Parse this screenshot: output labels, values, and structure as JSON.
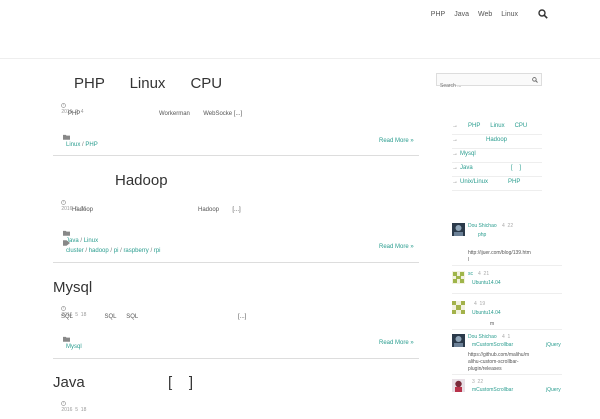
{
  "nav": {
    "items": [
      "PHP",
      "Java",
      "Web",
      "Linux"
    ]
  },
  "posts": [
    {
      "title": "PHP      Linux      CPU",
      "meta": "2016  9  4",
      "excerpt_a": "PHP",
      "excerpt_b": "Workerman        WebSocke [...]",
      "categories": [
        "Linux",
        "PHP"
      ],
      "read_more": "Read More"
    },
    {
      "title": "Hadoop",
      "meta": "2016  5  26",
      "excerpt_a": "Hadoop",
      "excerpt_b": "Hadoop        [...]",
      "categories": [
        "Java",
        "Linux"
      ],
      "tags": [
        "cluster",
        "hadoop",
        "pi",
        "raspberry",
        "rpi"
      ],
      "read_more": "Read More"
    },
    {
      "title": "Mysql",
      "meta": "2016  5  18",
      "excerpt_a": "SQL                   SQL      SQL",
      "excerpt_b": "[...]",
      "categories": [
        "Mysql"
      ],
      "read_more": "Read More"
    },
    {
      "title": "Java                    [    ]",
      "meta": "2016  5  18"
    }
  ],
  "sidebar": {
    "search_placeholder": "Search ...",
    "list": [
      "PHP      Linux      CPU",
      "Hadoop",
      "Mysql",
      "Java                       [    ]",
      "Unix/Linux            PHP"
    ],
    "comments": [
      {
        "author": "Dou Shichao",
        "time": "4  22",
        "line2": "php",
        "line3": "http://ijuer.com/blog/139.htm",
        "line4": "l"
      },
      {
        "author": "sc",
        "time": "4  21",
        "line2": "Ubuntu14.04"
      },
      {
        "time": "4  19",
        "line2": "Ubuntu14.04",
        "line3": "m"
      },
      {
        "author": "Dou Shichao",
        "time": "4  1",
        "line2": "mCustomScrollbar",
        "line2b": "jQuery",
        "line3": "https://github.com/malihu/m",
        "line4": "alihu-custom-scrollbar-",
        "line5": "plugin/releases"
      },
      {
        "time": "3  22",
        "line2": "mCustomScrollbar",
        "line2b": "jQuery"
      }
    ]
  }
}
